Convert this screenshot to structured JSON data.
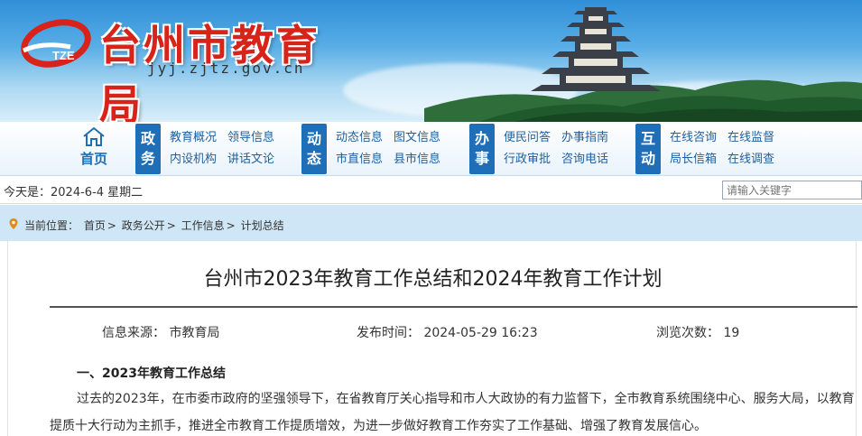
{
  "site": {
    "title": "台州市教育局",
    "domain": "jyj.zjtz.gov.cn",
    "logo_text": "TZE"
  },
  "nav": {
    "home_label": "首页",
    "groups": [
      {
        "tag": [
          "政",
          "务"
        ],
        "links": [
          "教育概况",
          "领导信息",
          "内设机构",
          "讲话文论"
        ]
      },
      {
        "tag": [
          "动",
          "态"
        ],
        "links": [
          "动态信息",
          "图文信息",
          "市直信息",
          "县市信息"
        ]
      },
      {
        "tag": [
          "办",
          "事"
        ],
        "links": [
          "便民问答",
          "办事指南",
          "行政审批",
          "咨询电话"
        ]
      },
      {
        "tag": [
          "互",
          "动"
        ],
        "links": [
          "在线咨询",
          "在线监督",
          "局长信箱",
          "在线调查"
        ]
      }
    ]
  },
  "datebar": {
    "date_text": "今天是：2024-6-4 星期二",
    "search_placeholder": "请输入关键字"
  },
  "breadcrumb": {
    "label": "当前位置：",
    "items": [
      "首页",
      "政务公开",
      "工作信息",
      "计划总结"
    ],
    "sep": ">"
  },
  "article": {
    "title": "台州市2023年教育工作总结和2024年教育工作计划",
    "meta": {
      "source_label": "信息来源：",
      "source_value": "市教育局",
      "time_label": "发布时间：",
      "time_value": "2024-05-29 16:23",
      "views_label": "浏览次数：",
      "views_value": "19"
    },
    "section_title": "一、2023年教育工作总结",
    "paragraph": "过去的2023年，在市委市政府的坚强领导下，在省教育厅关心指导和市人大政协的有力监督下，全市教育系统围绕中心、服务大局，以教育提质十大行动为主抓手，推进全市教育工作提质增效，为进一步做好教育工作夯实了工作基础、增强了教育发展信心。"
  },
  "colors": {
    "brand_red": "#d8231b",
    "nav_blue": "#1f6fb8",
    "crumb_bg": "#cfe6f6"
  }
}
